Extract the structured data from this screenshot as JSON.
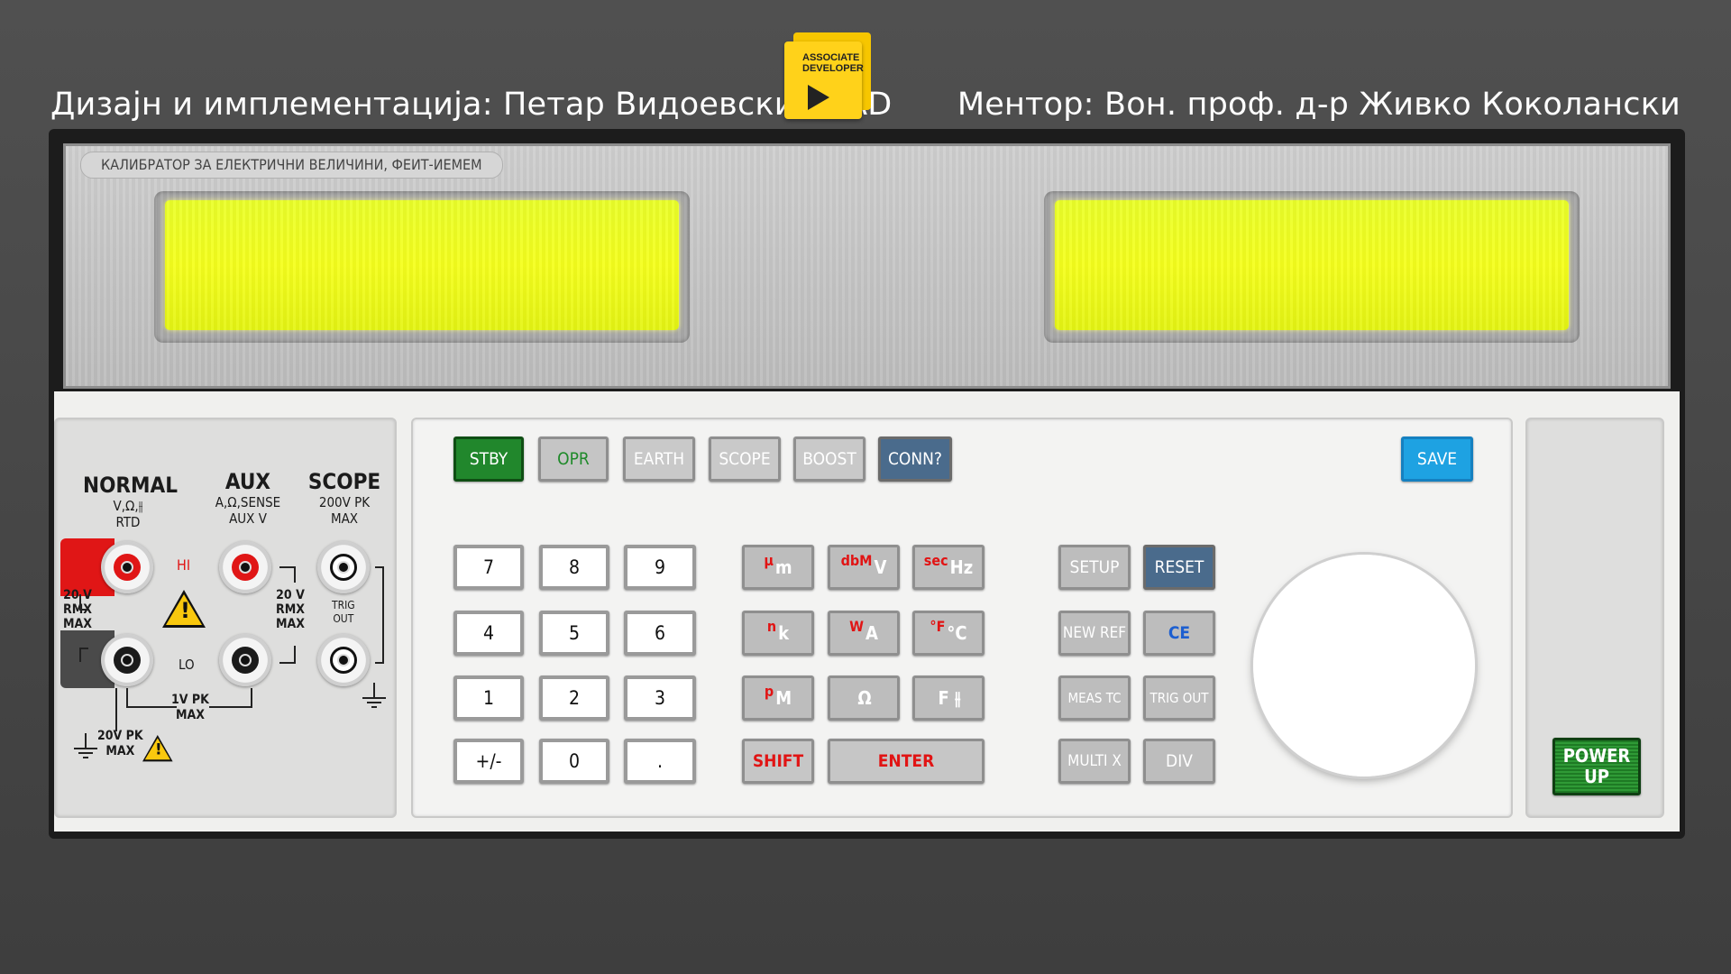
{
  "header": {
    "left_text": "Дизајн и имплементација: Петар Видоевски CLAD",
    "right_text": "Ментор: Вон. проф. д-р Живко Коколански",
    "logo_text": "ASSOCIATE DEVELOPER"
  },
  "device": {
    "brand_label": "КАЛИБРАТОР ЗА ЕЛЕКТРИЧНИ ВЕЛИЧИНИ, ФЕИТ-ИЕМЕМ",
    "displays": [
      "",
      ""
    ],
    "lcd_color": "#f2ff1f"
  },
  "terminals": {
    "normal": {
      "title": "NORMAL",
      "sub1": "V,Ω,⫲",
      "sub2": "RTD"
    },
    "aux": {
      "title": "AUX",
      "sub1": "A,Ω,SENSE",
      "sub2": "AUX V"
    },
    "scope": {
      "title": "SCOPE",
      "sub1": "200V PK",
      "sub2": "MAX"
    },
    "hi": "HI",
    "lo": "LO",
    "left_rating": [
      "20 V",
      "RMX",
      "MAX"
    ],
    "mid_rating": [
      "20 V",
      "RMX",
      "MAX"
    ],
    "trig_out": [
      "TRIG",
      "OUT"
    ],
    "bottom_rating": [
      "1V PK",
      "MAX"
    ],
    "ground_rating": [
      "20V PK",
      "MAX"
    ]
  },
  "mode_buttons": {
    "stby": "STBY",
    "opr": "OPR",
    "earth": "EARTH",
    "scope": "SCOPE",
    "boost": "BOOST",
    "conn": "CONN?",
    "save": "SAVE"
  },
  "keypad": [
    "7",
    "8",
    "9",
    "4",
    "5",
    "6",
    "1",
    "2",
    "3",
    "+/-",
    "0",
    "."
  ],
  "unit_buttons": [
    {
      "sup": "µ",
      "main": "m"
    },
    {
      "sup": "dbM",
      "main": "V"
    },
    {
      "sup": "sec",
      "main": "Hz"
    },
    {
      "sup": "n",
      "main": "k"
    },
    {
      "sup": "W",
      "main": "A"
    },
    {
      "sup": "°F",
      "main": "°C"
    },
    {
      "sup": "p",
      "main": "M"
    },
    {
      "sup": "",
      "main": "Ω"
    },
    {
      "sup": "",
      "main": "F ⫲"
    }
  ],
  "shift_label": "SHIFT",
  "enter_label": "ENTER",
  "function_buttons": {
    "setup": "SETUP",
    "reset": "RESET",
    "new_ref": "NEW REF",
    "ce": "CE",
    "meas_tc": "MEAS TC",
    "trig_out": "TRIG OUT",
    "multi_x": "MULTI X",
    "div": "DIV"
  },
  "power": [
    "POWER",
    "UP"
  ],
  "colors": {
    "stby": "#21872c",
    "save": "#1ea2e2",
    "conn": "#4a6b8c",
    "power": "#1e7a24",
    "unit_prefix": "#e11414"
  }
}
